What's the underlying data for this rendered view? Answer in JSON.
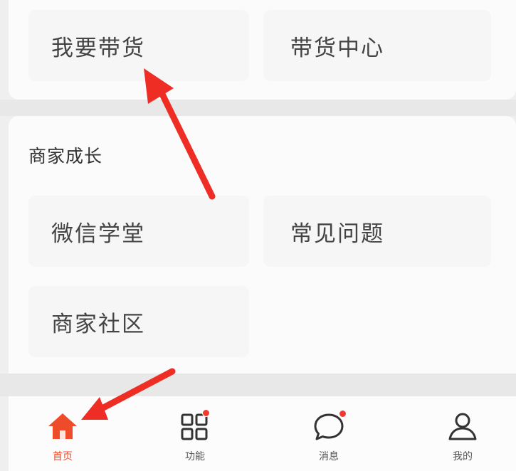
{
  "top_card": {
    "items": [
      {
        "label": "我要带货"
      },
      {
        "label": "带货中心"
      }
    ]
  },
  "merchant_growth": {
    "title": "商家成长",
    "items": [
      {
        "label": "微信学堂"
      },
      {
        "label": "常见问题"
      },
      {
        "label": "商家社区"
      }
    ]
  },
  "bottom_nav": {
    "items": [
      {
        "label": "首页",
        "icon": "home-icon",
        "active": true
      },
      {
        "label": "功能",
        "icon": "grid-icon",
        "badge": true
      },
      {
        "label": "消息",
        "icon": "message-icon",
        "badge": true
      },
      {
        "label": "我的",
        "icon": "user-icon"
      }
    ]
  },
  "colors": {
    "accent": "#ee4b2b",
    "badge": "#f03a2e",
    "annotation_arrow": "#ee2e24"
  }
}
